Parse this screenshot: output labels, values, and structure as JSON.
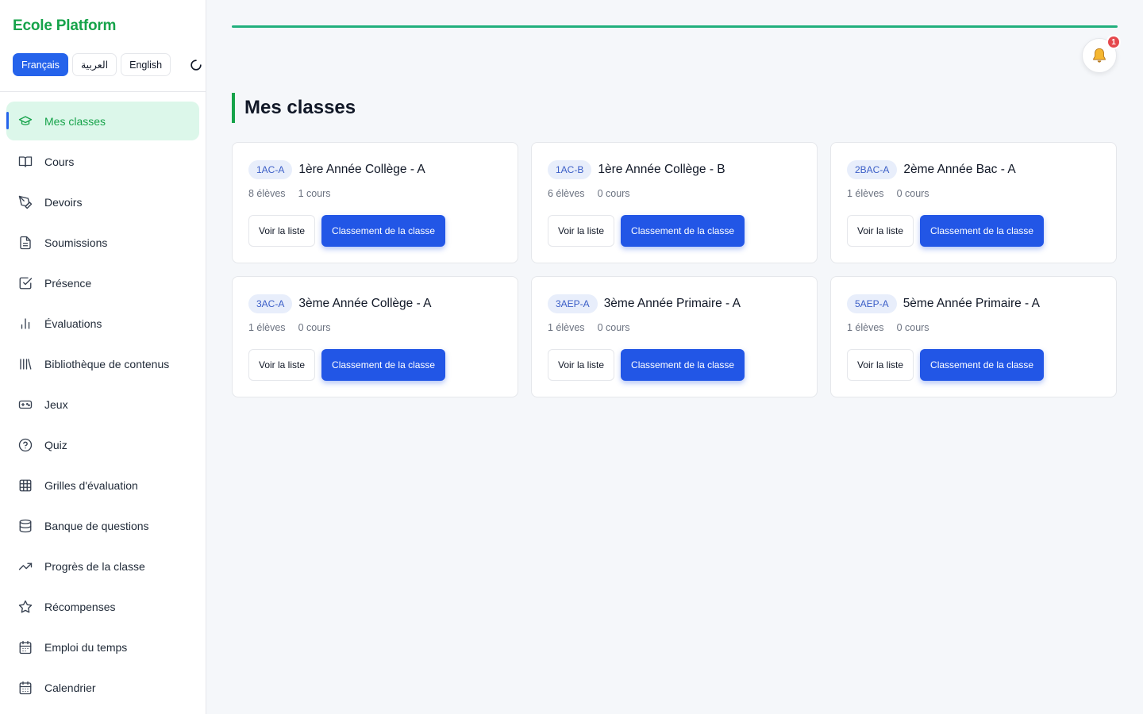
{
  "app": {
    "brand": "Ecole Platform"
  },
  "languages": [
    {
      "label": "Français",
      "active": true
    },
    {
      "label": "العربية",
      "active": false
    },
    {
      "label": "English",
      "active": false
    }
  ],
  "nav": [
    {
      "label": "Mes classes",
      "icon": "graduation-cap-icon",
      "active": true
    },
    {
      "label": "Cours",
      "icon": "book-open-icon"
    },
    {
      "label": "Devoirs",
      "icon": "pen-tool-icon"
    },
    {
      "label": "Soumissions",
      "icon": "file-text-icon"
    },
    {
      "label": "Présence",
      "icon": "check-square-icon"
    },
    {
      "label": "Évaluations",
      "icon": "bar-chart-icon"
    },
    {
      "label": "Bibliothèque de contenus",
      "icon": "library-icon"
    },
    {
      "label": "Jeux",
      "icon": "gamepad-icon"
    },
    {
      "label": "Quiz",
      "icon": "help-circle-icon"
    },
    {
      "label": "Grilles d'évaluation",
      "icon": "grid-table-icon"
    },
    {
      "label": "Banque de questions",
      "icon": "database-icon"
    },
    {
      "label": "Progrès de la classe",
      "icon": "trending-up-icon"
    },
    {
      "label": "Récompenses",
      "icon": "star-icon"
    },
    {
      "label": "Emploi du temps",
      "icon": "calendar-icon"
    },
    {
      "label": "Calendrier",
      "icon": "calendar-days-icon"
    }
  ],
  "notifications": {
    "count": "1",
    "icon": "bell-icon"
  },
  "main": {
    "title": "Mes classes"
  },
  "classes": [
    {
      "code": "1AC-A",
      "name": "1ère Année Collège - A",
      "students": "8 élèves",
      "courses": "1 cours",
      "list_btn": "Voir la liste",
      "rank_btn": "Classement de la classe"
    },
    {
      "code": "1AC-B",
      "name": "1ère Année Collège - B",
      "students": "6 élèves",
      "courses": "0 cours",
      "list_btn": "Voir la liste",
      "rank_btn": "Classement de la classe"
    },
    {
      "code": "2BAC-A",
      "name": "2ème Année Bac - A",
      "students": "1 élèves",
      "courses": "0 cours",
      "list_btn": "Voir la liste",
      "rank_btn": "Classement de la classe"
    },
    {
      "code": "3AC-A",
      "name": "3ème Année Collège - A",
      "students": "1 élèves",
      "courses": "0 cours",
      "list_btn": "Voir la liste",
      "rank_btn": "Classement de la classe"
    },
    {
      "code": "3AEP-A",
      "name": "3ème Année Primaire - A",
      "students": "1 élèves",
      "courses": "0 cours",
      "list_btn": "Voir la liste",
      "rank_btn": "Classement de la classe"
    },
    {
      "code": "5AEP-A",
      "name": "5ème Année Primaire - A",
      "students": "1 élèves",
      "courses": "0 cours",
      "list_btn": "Voir la liste",
      "rank_btn": "Classement de la classe"
    }
  ],
  "colors": {
    "accent_green": "#16a34a",
    "primary_blue": "#2256e6",
    "badge_red": "#e5484d"
  }
}
